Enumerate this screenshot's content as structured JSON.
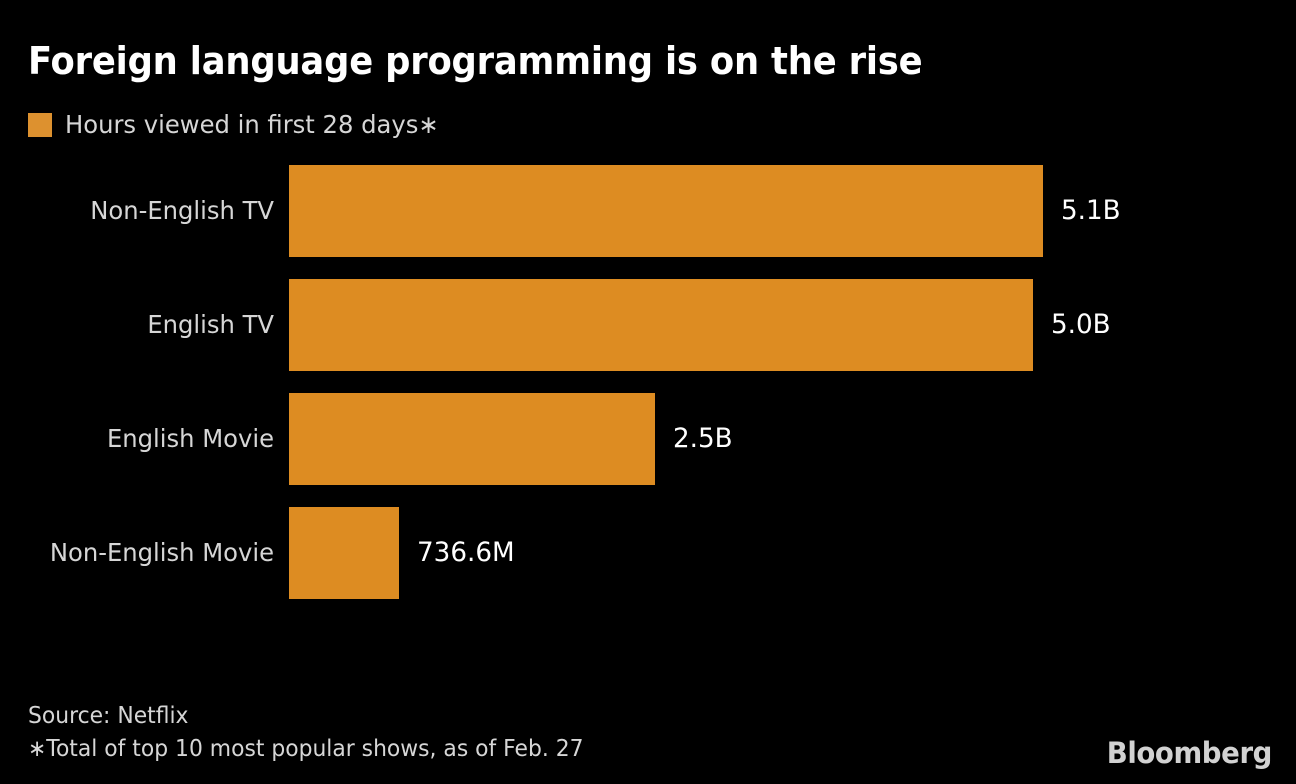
{
  "theme": {
    "background": "#000000",
    "bar_color": "#DD8C22",
    "legend_swatch_color": "#DD912F",
    "title_color": "#FFFFFF",
    "label_color": "#D6D6D6",
    "value_color": "#FFFFFF",
    "brand_color": "#D2D2D2"
  },
  "header": {
    "title": "Foreign language programming is on the rise"
  },
  "legend": {
    "items": [
      {
        "label": "Hours viewed in first 28 days∗",
        "color": "#DD912F",
        "swatch": "square-swatch-icon"
      }
    ]
  },
  "footer": {
    "source": "Source: Netflix",
    "note": "∗Total of top 10 most popular shows, as of Feb. 27",
    "brand": "Bloomberg"
  },
  "chart_data": {
    "type": "bar",
    "orientation": "horizontal",
    "title": "Foreign language programming is on the rise",
    "subtitle": "Hours viewed in first 28 days∗",
    "xlabel": "",
    "ylabel": "",
    "grid": false,
    "legend_position": "top-left",
    "series_name": "Hours viewed in first 28 days",
    "unit": "hours viewed",
    "color": "#DD8C22",
    "categories": [
      "Non-English TV",
      "English TV",
      "English Movie",
      "Non-English Movie"
    ],
    "values": [
      5100000000,
      5000000000,
      2500000000,
      736600000
    ],
    "value_labels": [
      "5.1B",
      "5.0B",
      "2.5B",
      "736.6M"
    ],
    "xlim": [
      0,
      5100000000
    ],
    "bars": [
      {
        "category": "Non-English TV",
        "value": 5100000000,
        "value_label": "5.1B",
        "width_pct": 100.0
      },
      {
        "category": "English TV",
        "value": 5000000000,
        "value_label": "5.0B",
        "width_pct": 98.7
      },
      {
        "category": "English Movie",
        "value": 2500000000,
        "value_label": "2.5B",
        "width_pct": 48.5
      },
      {
        "category": "Non-English Movie",
        "value": 736600000,
        "value_label": "736.6M",
        "width_pct": 14.6
      }
    ]
  }
}
